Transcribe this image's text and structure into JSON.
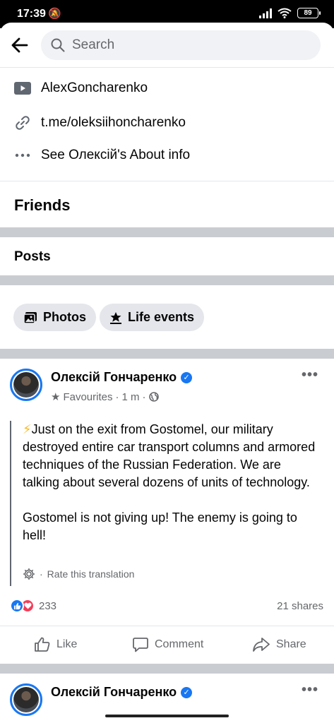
{
  "status_bar": {
    "time": "17:39",
    "battery": "89"
  },
  "search": {
    "placeholder": "Search"
  },
  "intro": {
    "youtube": "AlexGoncharenko",
    "link": "t.me/oleksiihoncharenko",
    "about": "See Олексій's About info"
  },
  "sections": {
    "friends": "Friends",
    "posts": "Posts"
  },
  "chips": {
    "photos": "Photos",
    "life_events": "Life events"
  },
  "post": {
    "author": "Олексій Гончаренко",
    "audience": "Favourites",
    "time": "1 m",
    "text": "Just on the exit from Gostomel, our military destroyed entire car transport columns and armored techniques of the Russian Federation. We are talking about several dozens of units of technology.\n\nGostomel is not giving up! The enemy is going to hell!",
    "rate_translation": "Rate this translation",
    "reaction_count": "233",
    "shares": "21 shares",
    "actions": {
      "like": "Like",
      "comment": "Comment",
      "share": "Share"
    }
  },
  "next_post": {
    "author": "Олексій Гончаренко"
  },
  "colors": {
    "accent": "#1877f2",
    "secondary_text": "#65676b",
    "band": "#c9ccd1"
  }
}
